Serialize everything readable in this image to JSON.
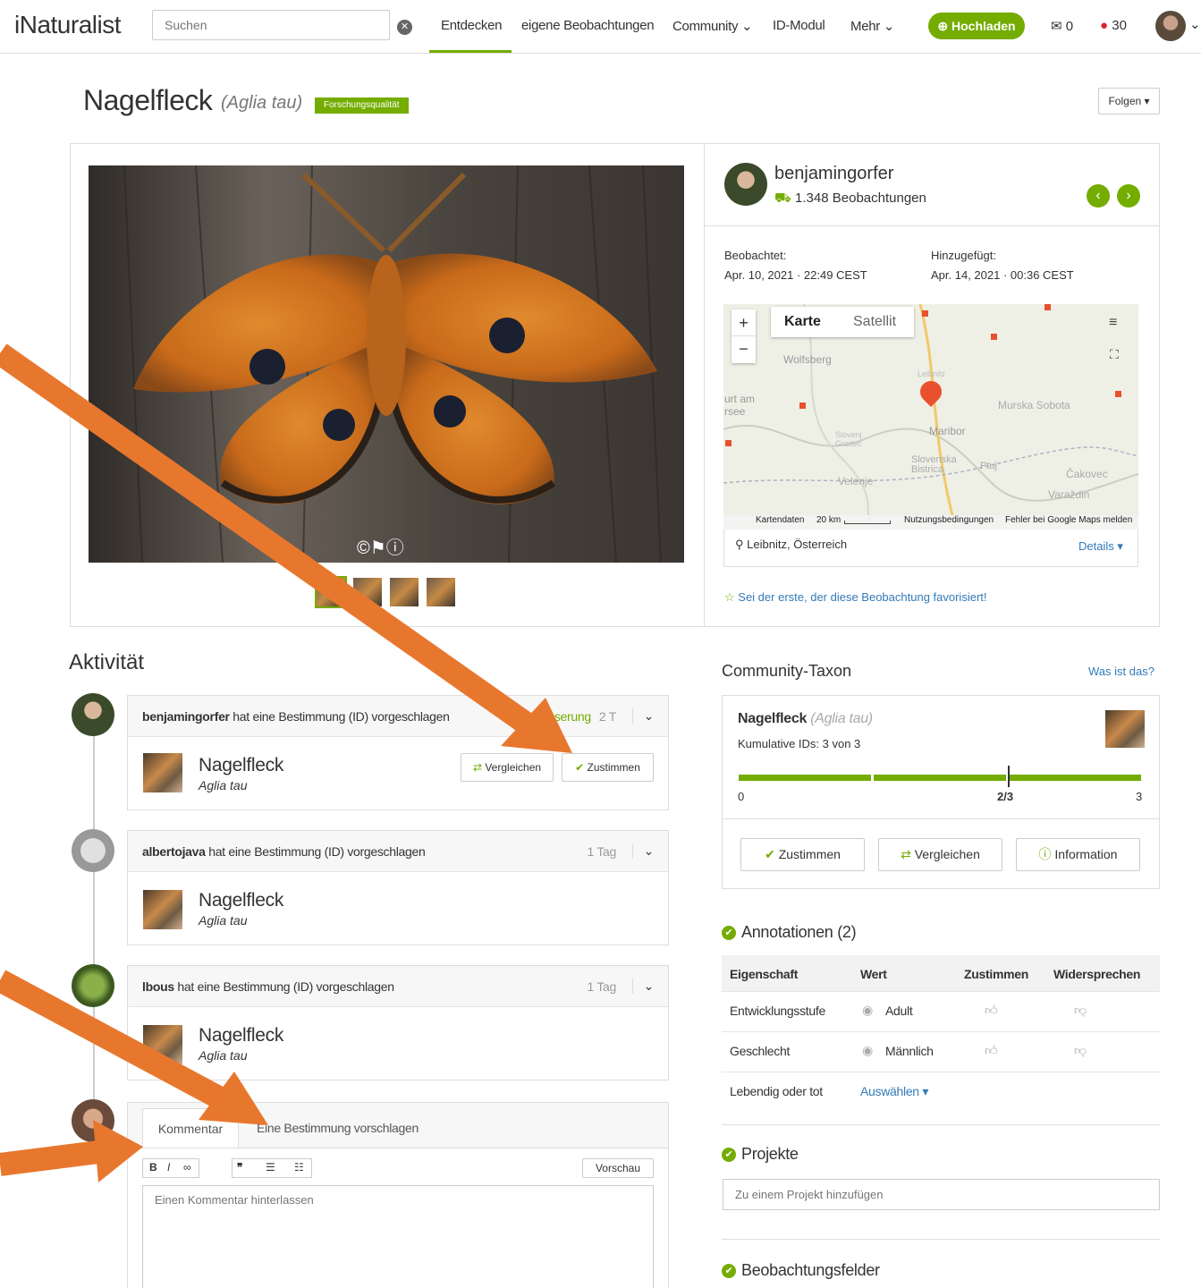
{
  "header": {
    "logo": "iNaturalist",
    "search_placeholder": "Suchen",
    "nav": [
      "Entdecken",
      "eigene Beobachtungen",
      "Community",
      "ID-Modul",
      "Mehr"
    ],
    "upload_label": "Hochladen",
    "messages_count": "0",
    "notifications_count": "30"
  },
  "observation": {
    "common_name": "Nagelfleck",
    "scientific_name": "(Aglia tau)",
    "quality_badge": "Forschungsqualität",
    "follow_label": "Folgen"
  },
  "observer": {
    "username": "benjamingorfer",
    "observations_count": "1.348 Beobachtungen"
  },
  "dates": {
    "observed_label": "Beobachtet:",
    "observed_value": "Apr. 10, 2021 · 22:49 CEST",
    "added_label": "Hinzugefügt:",
    "added_value": "Apr. 14, 2021 · 00:36 CEST"
  },
  "map": {
    "tab_map": "Karte",
    "tab_satellite": "Satellit",
    "places": [
      "Wolfsberg",
      "Leibnitz",
      "Maribor",
      "Murska Sobota",
      "Slovenj Gradec",
      "Slovenska Bistrica",
      "Ptuj",
      "Velenje",
      "Čakovec",
      "Varaždin",
      "urt am",
      "rsee"
    ],
    "footer": [
      "Kartendaten",
      "20 km",
      "Nutzungsbedingungen",
      "Fehler bei Google Maps melden"
    ],
    "location": "Leibnitz, Österreich",
    "details_label": "Details"
  },
  "favorite_text": "Sei der erste, der diese Beobachtung favorisiert!",
  "activity": {
    "title": "Aktivität",
    "items": [
      {
        "user": "benjamingorfer",
        "action": " hat eine Bestimmung (ID) vorgeschlagen",
        "tag": "Verbesserung",
        "time": "2 T",
        "taxon": "Nagelfleck",
        "sci": "Aglia tau",
        "compare": "Vergleichen",
        "agree": "Zustimmen"
      },
      {
        "user": "albertojava",
        "action": " hat eine Bestimmung (ID) vorgeschlagen",
        "time": "1 Tag",
        "taxon": "Nagelfleck",
        "sci": "Aglia tau"
      },
      {
        "user": "lbous",
        "action": " hat eine Bestimmung (ID) vorgeschlagen",
        "time": "1 Tag",
        "taxon": "Nagelfleck",
        "sci": "Aglia tau"
      }
    ],
    "comment_tab": "Kommentar",
    "suggest_tab": "Eine Bestimmung vorschlagen",
    "preview_label": "Vorschau",
    "comment_placeholder": "Einen Kommentar hinterlassen"
  },
  "community_taxon": {
    "title": "Community-Taxon",
    "what_is_this": "Was ist das?",
    "name": "Nagelfleck",
    "sci": "(Aglia tau)",
    "cumulative": "Kumulative IDs: 3 von 3",
    "scale_min": "0",
    "scale_mid": "2/3",
    "scale_max": "3",
    "agree": "Zustimmen",
    "compare": "Vergleichen",
    "info": "Information"
  },
  "annotations": {
    "title": "Annotationen (2)",
    "headers": [
      "Eigenschaft",
      "Wert",
      "Zustimmen",
      "Widersprechen"
    ],
    "rows": [
      {
        "attr": "Entwicklungsstufe",
        "value": "Adult"
      },
      {
        "attr": "Geschlecht",
        "value": "Männlich"
      },
      {
        "attr": "Lebendig oder tot",
        "value": "Auswählen"
      }
    ]
  },
  "projects": {
    "title": "Projekte",
    "placeholder": "Zu einem Projekt hinzufügen"
  },
  "fields": {
    "title": "Beobachtungsfelder"
  },
  "colors": {
    "accent": "#74ac00",
    "arrow": "#e8772e",
    "link": "#337ab7"
  }
}
